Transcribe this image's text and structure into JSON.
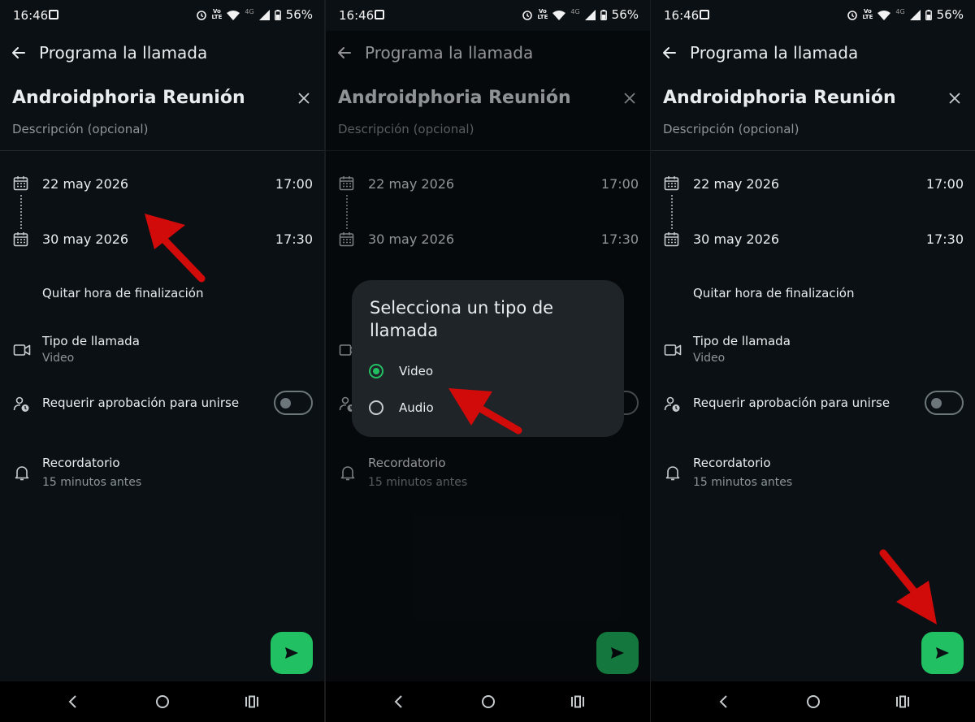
{
  "status_bar": {
    "time": "16:46",
    "battery": "56%",
    "network": "4G",
    "volte": "Vo)) LTE"
  },
  "header": {
    "title": "Programa la llamada"
  },
  "event": {
    "title": "Androidphoria Reunión",
    "description_placeholder": "Descripción (opcional)"
  },
  "schedule": {
    "start_date": "22 may 2026",
    "start_time": "17:00",
    "end_date": "30 may 2026",
    "end_time": "17:30",
    "remove_end_label": "Quitar hora de finalización"
  },
  "call_type": {
    "label": "Tipo de llamada",
    "value": "Video"
  },
  "approval": {
    "label": "Requerir aprobación para unirse",
    "enabled": false
  },
  "reminder": {
    "label": "Recordatorio",
    "value": "15 minutos antes"
  },
  "dialog": {
    "title": "Selecciona un tipo de llamada",
    "options": [
      {
        "label": "Video",
        "selected": true
      },
      {
        "label": "Audio",
        "selected": false
      }
    ]
  },
  "colors": {
    "accent": "#21c063",
    "background": "#0b1014",
    "annotation_arrow": "#d10a0a"
  }
}
